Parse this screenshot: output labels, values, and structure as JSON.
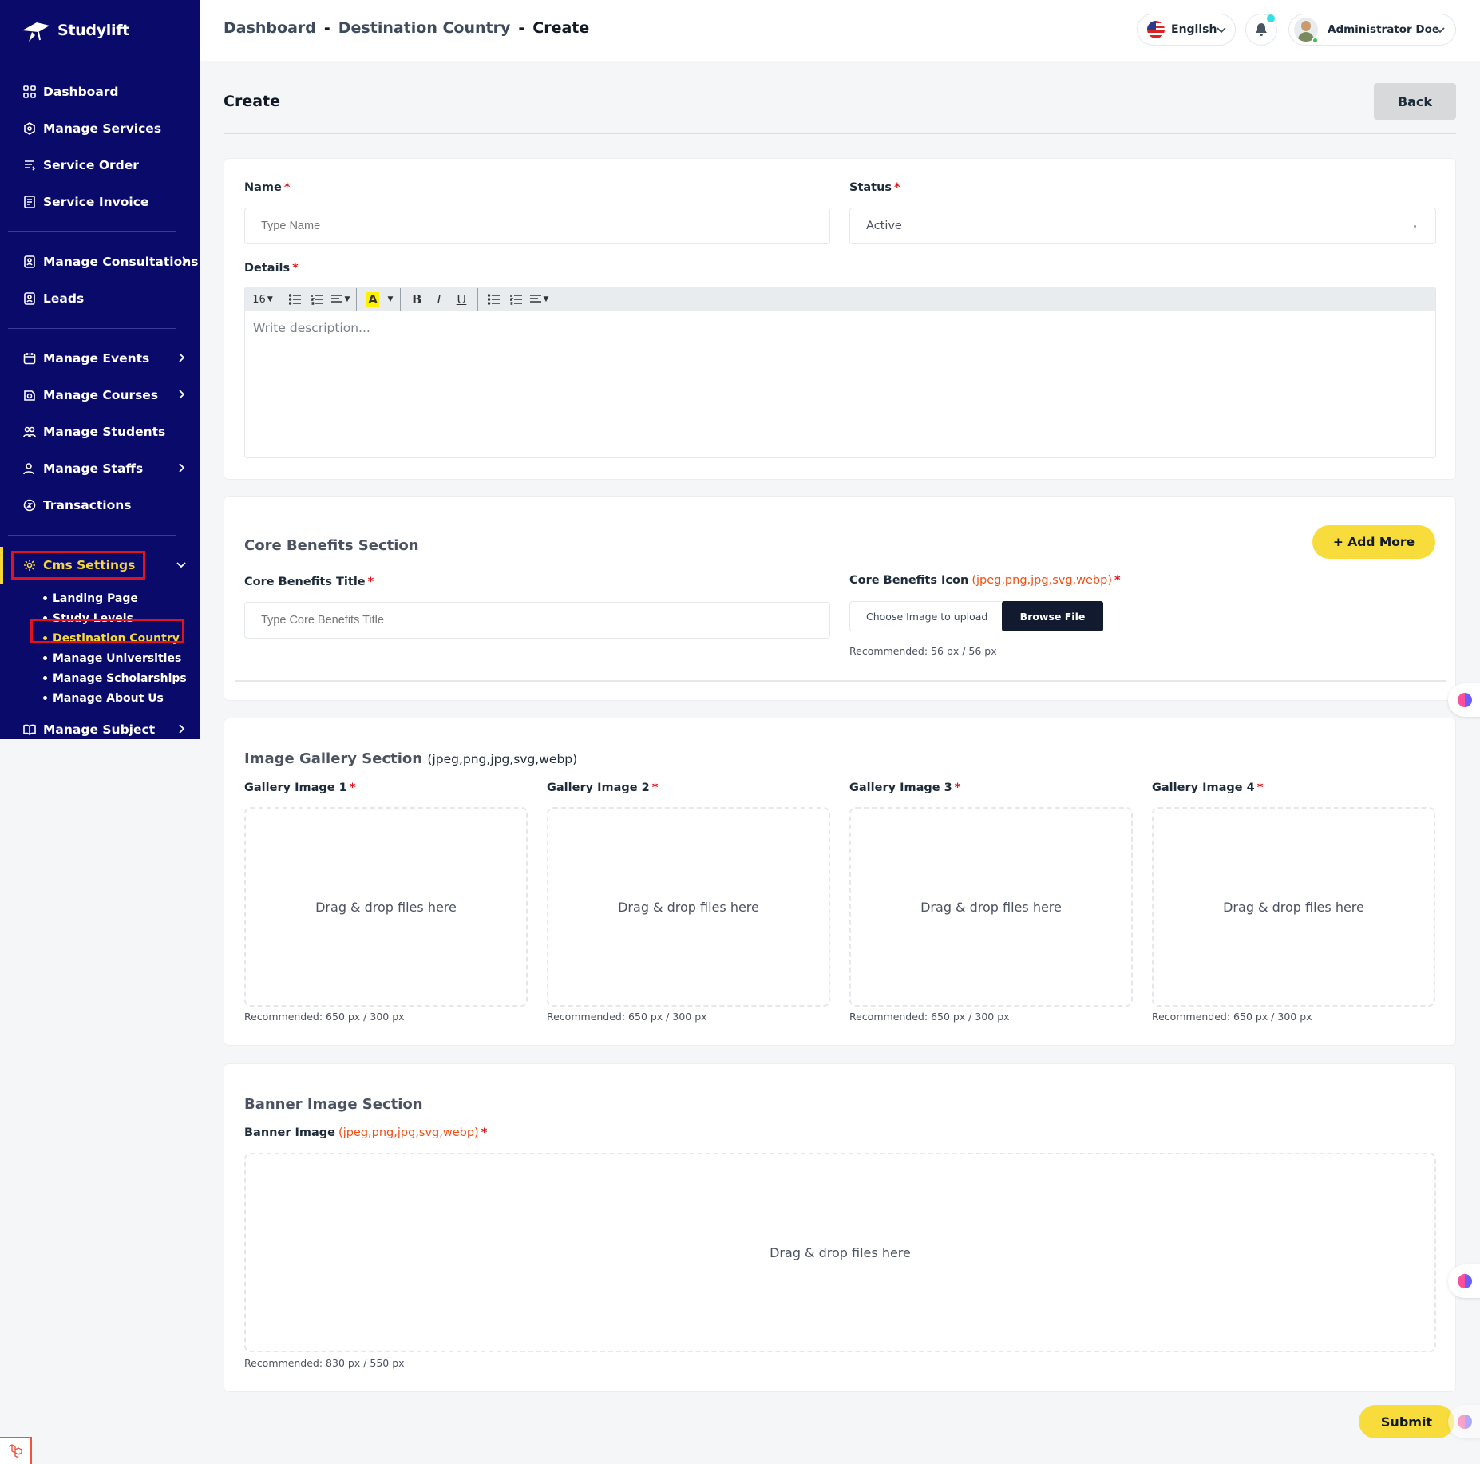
{
  "app": {
    "brand": "Studylift"
  },
  "sidebar": {
    "group1": [
      {
        "label": "Dashboard",
        "icon": "dashboard-icon"
      },
      {
        "label": "Manage Services",
        "icon": "services-icon"
      },
      {
        "label": "Service Order",
        "icon": "order-icon"
      },
      {
        "label": "Service Invoice",
        "icon": "invoice-icon"
      }
    ],
    "group2": [
      {
        "label": "Manage Consultations",
        "icon": "consultations-icon"
      },
      {
        "label": "Leads",
        "icon": "leads-icon"
      }
    ],
    "group3": [
      {
        "label": "Manage Events",
        "icon": "calendar-icon"
      },
      {
        "label": "Manage Courses",
        "icon": "courses-icon"
      },
      {
        "label": "Manage Students",
        "icon": "students-icon"
      },
      {
        "label": "Manage Staffs",
        "icon": "staffs-icon"
      },
      {
        "label": "Transactions",
        "icon": "transactions-icon"
      }
    ],
    "cms": {
      "label": "Cms Settings",
      "icon": "settings-icon",
      "sub": [
        "Landing Page",
        "Study Levels",
        "Destination Country",
        "Manage Universities",
        "Manage Scholarships",
        "Manage About Us"
      ],
      "active_sub": "Destination Country"
    },
    "subject": {
      "label": "Manage Subject",
      "icon": "book-icon"
    },
    "accent_color": "#f5d836",
    "bg_color": "#0a0a6b"
  },
  "header": {
    "breadcrumb": [
      "Dashboard",
      "Destination Country",
      "Create"
    ],
    "separator": "-",
    "language": "English",
    "user_name": "Administrator Doe"
  },
  "page": {
    "title": "Create",
    "back_label": "Back",
    "submit_label": "Submit"
  },
  "form": {
    "name_label": "Name",
    "name_placeholder": "Type Name",
    "status_label": "Status",
    "status_value": "Active",
    "details_label": "Details",
    "details_placeholder": "Write description...",
    "font_size": "16",
    "required_mark": "*"
  },
  "core_benefits": {
    "section_title": "Core Benefits Section",
    "add_more_label": "+ Add More",
    "title_label": "Core Benefits Title",
    "title_placeholder": "Type Core Benefits Title",
    "icon_label": "Core Benefits Icon",
    "icon_ext": "(jpeg,png,jpg,svg,webp)",
    "choose_text": "Choose Image to upload",
    "browse_label": "Browse File",
    "recommended": "Recommended: 56 px / 56 px"
  },
  "gallery": {
    "section_title": "Image Gallery Section",
    "section_ext": "(jpeg,png,jpg,svg,webp)",
    "items": [
      {
        "label": "Gallery Image 1",
        "drop": "Drag & drop files here",
        "recommended": "Recommended: 650 px / 300 px"
      },
      {
        "label": "Gallery Image 2",
        "drop": "Drag & drop files here",
        "recommended": "Recommended: 650 px / 300 px"
      },
      {
        "label": "Gallery Image 3",
        "drop": "Drag & drop files here",
        "recommended": "Recommended: 650 px / 300 px"
      },
      {
        "label": "Gallery Image 4",
        "drop": "Drag & drop files here",
        "recommended": "Recommended: 650 px / 300 px"
      }
    ]
  },
  "banner": {
    "section_title": "Banner Image Section",
    "label": "Banner Image",
    "ext": "(jpeg,png,jpg,svg,webp)",
    "drop": "Drag & drop files here",
    "recommended": "Recommended: 830 px / 550 px"
  }
}
